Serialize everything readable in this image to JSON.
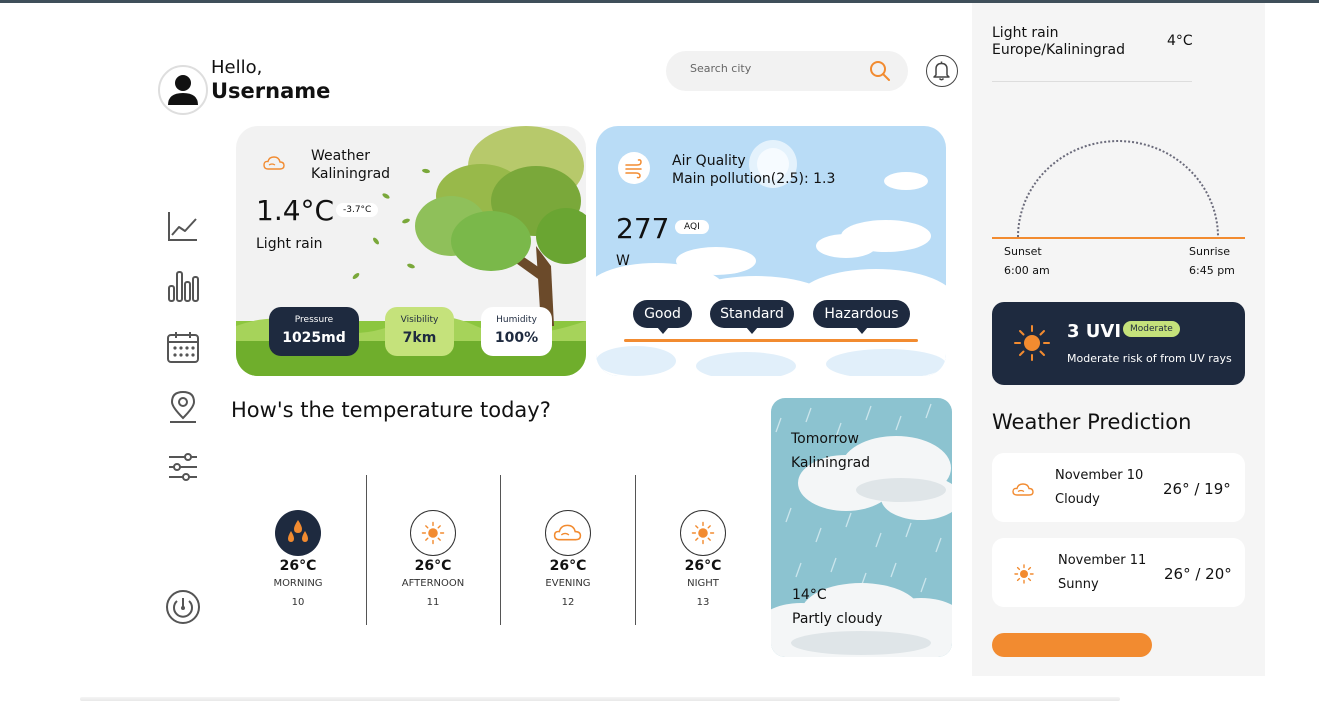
{
  "header": {
    "greeting": "Hello,",
    "username": "Username",
    "search_placeholder": "Search city"
  },
  "weather_card": {
    "title": "Weather",
    "city": "Kaliningrad",
    "temperature": "1.4°C",
    "feels_like": "-3.7°C",
    "condition": "Light rain",
    "stats": [
      {
        "label": "Pressure",
        "value": "1025md"
      },
      {
        "label": "Visibility",
        "value": "7km"
      },
      {
        "label": "Humidity",
        "value": "100%"
      }
    ]
  },
  "air_card": {
    "title": "Air Quality",
    "pollution": "Main pollution(2.5): 1.3",
    "value": "277",
    "badge": "AQI",
    "unit": "W",
    "levels": [
      "Good",
      "Standard",
      "Hazardous"
    ]
  },
  "temperature_today": {
    "heading": "How's the temperature today?",
    "periods": [
      {
        "temp": "26°C",
        "name": "MORNING",
        "day": "10",
        "icon": "raindrops-icon"
      },
      {
        "temp": "26°C",
        "name": "AFTERNOON",
        "day": "11",
        "icon": "sun-icon"
      },
      {
        "temp": "26°C",
        "name": "EVENING",
        "day": "12",
        "icon": "cloud-icon"
      },
      {
        "temp": "26°C",
        "name": "NIGHT",
        "day": "13",
        "icon": "sun-icon"
      }
    ]
  },
  "tomorrow_card": {
    "label": "Tomorrow",
    "city": "Kaliningrad",
    "temp": "14°C",
    "condition": "Partly cloudy"
  },
  "right_panel": {
    "condition": "Light rain",
    "timezone": "Europe/Kaliningrad",
    "temp": "4°C",
    "sunset_label": "Sunset",
    "sunset_time": "6:00 am",
    "sunrise_label": "Sunrise",
    "sunrise_time": "6:45 pm",
    "uvi": {
      "value": "3 UVI",
      "badge": "Moderate",
      "text": "Moderate risk of from UV rays"
    },
    "prediction_heading": "Weather Prediction",
    "predictions": [
      {
        "date": "November 10",
        "condition": "Cloudy",
        "range": "26° / 19°",
        "icon": "cloud-icon"
      },
      {
        "date": "November 11",
        "condition": "Sunny",
        "range": "26° / 20°",
        "icon": "sun-icon"
      }
    ]
  },
  "colors": {
    "accent": "#f28b30",
    "navy": "#1e2a3f",
    "lime": "#c5e27b",
    "sky": "#b9dcf6"
  }
}
